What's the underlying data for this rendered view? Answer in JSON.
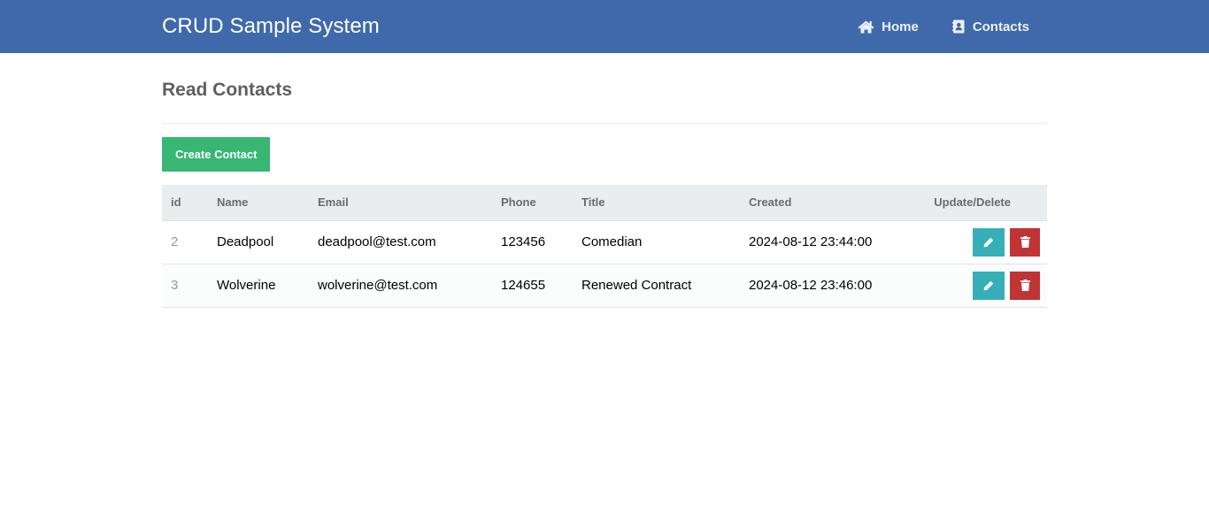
{
  "header": {
    "brand": "CRUD Sample System",
    "nav": [
      {
        "label": "Home",
        "icon": "home-icon"
      },
      {
        "label": "Contacts",
        "icon": "address-book-icon"
      }
    ]
  },
  "page": {
    "title": "Read Contacts",
    "create_label": "Create Contact"
  },
  "table": {
    "columns": [
      "id",
      "Name",
      "Email",
      "Phone",
      "Title",
      "Created",
      "Update/Delete"
    ],
    "rows": [
      {
        "id": "2",
        "name": "Deadpool",
        "email": "deadpool@test.com",
        "phone": "123456",
        "title": "Comedian",
        "created": "2024-08-12 23:44:00"
      },
      {
        "id": "3",
        "name": "Wolverine",
        "email": "wolverine@test.com",
        "phone": "124655",
        "title": "Renewed Contract",
        "created": "2024-08-12 23:46:00"
      }
    ]
  },
  "colors": {
    "header_bg": "#3f69aa",
    "create_button": "#38b673",
    "edit_button": "#37afb8",
    "delete_button": "#bf3434"
  },
  "icons": {
    "edit": "pencil-icon",
    "delete": "trash-icon"
  }
}
